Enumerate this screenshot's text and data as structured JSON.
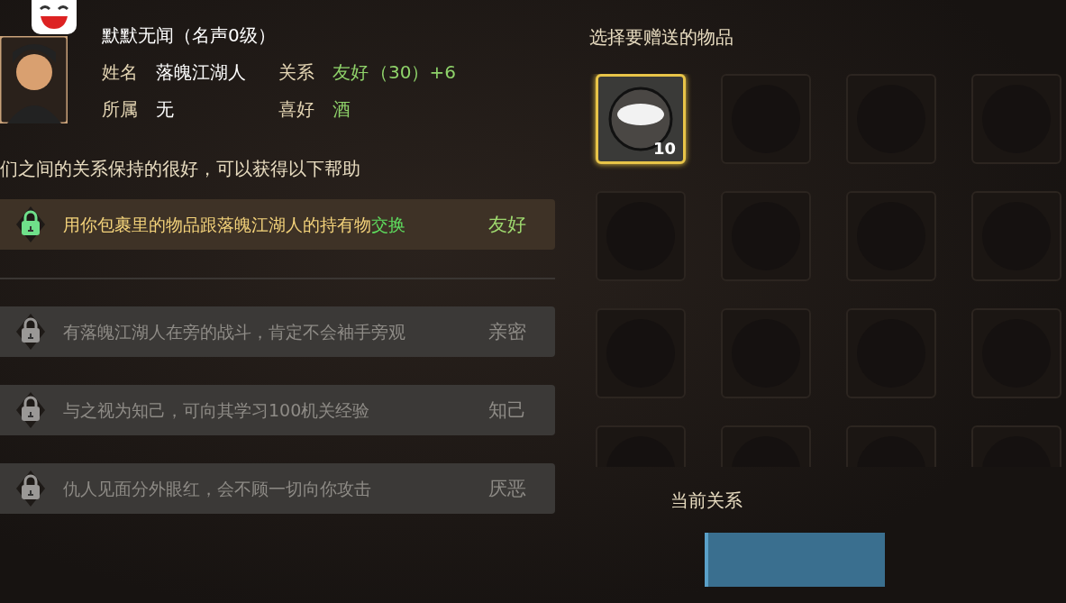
{
  "profile": {
    "title": "默默无闻（名声0级）",
    "name_label": "姓名",
    "name": "落魄江湖人",
    "relation_label": "关系",
    "relation": "友好",
    "relation_value": "（30）+6",
    "faction_label": "所属",
    "faction": "无",
    "hobby_label": "喜好",
    "hobby": "酒"
  },
  "description": "们之间的关系保持的很好，可以获得以下帮助",
  "benefits": [
    {
      "text": "用你包裹里的物品跟落魄江湖人的持有物",
      "highlight": "交换",
      "tier": "友好",
      "unlocked": true
    },
    {
      "text": "有落魄江湖人在旁的战斗，肯定不会袖手旁观",
      "tier": "亲密",
      "unlocked": false
    },
    {
      "text": "与之视为知己，可向其学习100机关经验",
      "tier": "知己",
      "unlocked": false
    },
    {
      "text": "仇人见面分外眼红，会不顾一切向你攻击",
      "tier": "厌恶",
      "unlocked": false
    }
  ],
  "gift": {
    "title": "选择要赠送的物品",
    "slots": [
      {
        "count": "10",
        "selected": true
      },
      {
        "selected": false
      },
      {
        "selected": false
      },
      {
        "selected": false
      },
      {
        "selected": false
      },
      {
        "selected": false
      },
      {
        "selected": false
      },
      {
        "selected": false
      },
      {
        "selected": false
      },
      {
        "selected": false
      },
      {
        "selected": false
      },
      {
        "selected": false
      },
      {
        "selected": false
      },
      {
        "selected": false
      },
      {
        "selected": false
      },
      {
        "selected": false
      }
    ]
  },
  "footer": {
    "status": "当前关系"
  }
}
